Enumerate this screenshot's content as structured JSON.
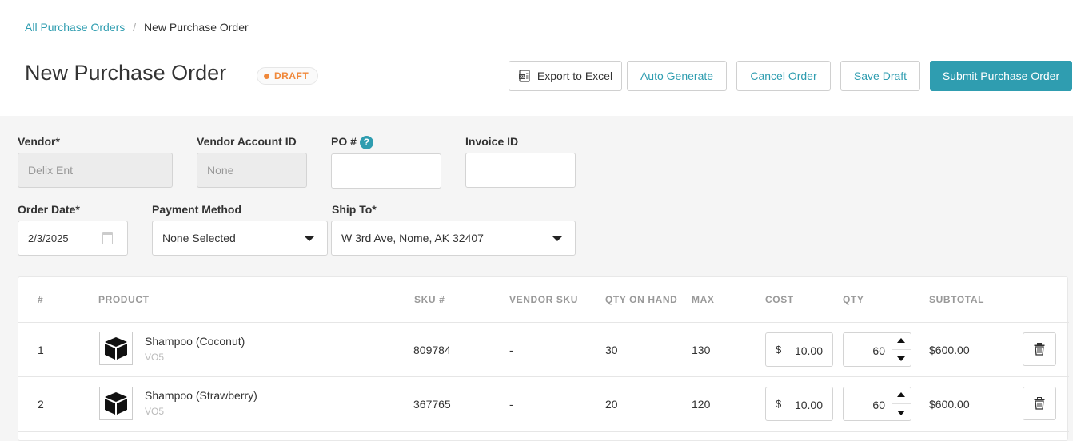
{
  "breadcrumb": {
    "parent": "All Purchase Orders",
    "separator": "/",
    "current": "New Purchase Order"
  },
  "page": {
    "title": "New Purchase Order",
    "status": "DRAFT"
  },
  "toolbar": {
    "export_label": "Export to Excel",
    "auto_label": "Auto Generate",
    "cancel_label": "Cancel Order",
    "save_label": "Save Draft",
    "submit_label": "Submit Purchase Order"
  },
  "form": {
    "vendor_label": "Vendor*",
    "vendor_value": "Delix Ent",
    "vendor_account_label": "Vendor Account ID",
    "vendor_account_value": "None",
    "po_label": "PO #",
    "po_value": "",
    "invoice_label": "Invoice ID",
    "invoice_value": "",
    "order_date_label": "Order Date*",
    "order_date_value": "2/3/2025",
    "payment_label": "Payment Method",
    "payment_value": "None Selected",
    "ship_label": "Ship To*",
    "ship_value": "W 3rd Ave, Nome, AK 32407"
  },
  "table": {
    "headers": {
      "num": "#",
      "product": "PRODUCT",
      "sku": "SKU #",
      "vendor_sku": "VENDOR SKU",
      "qty_on_hand": "QTY ON HAND",
      "max": "MAX",
      "cost": "COST",
      "qty": "QTY",
      "subtotal": "SUBTOTAL"
    },
    "currency_symbol": "$",
    "rows": [
      {
        "num": "1",
        "name": "Shampoo (Coconut)",
        "brand": "VO5",
        "sku": "809784",
        "vendor_sku": "-",
        "qty_on_hand": "30",
        "max": "130",
        "cost": "10.00",
        "qty": "60",
        "subtotal": "$600.00"
      },
      {
        "num": "2",
        "name": "Shampoo (Strawberry)",
        "brand": "VO5",
        "sku": "367765",
        "vendor_sku": "-",
        "qty_on_hand": "20",
        "max": "120",
        "cost": "10.00",
        "qty": "60",
        "subtotal": "$600.00"
      }
    ]
  },
  "colors": {
    "accent": "#2f9db0",
    "draft": "#f0883a"
  },
  "icons": {
    "export": "excel-icon",
    "help": "help-icon",
    "calendar": "calendar-icon",
    "dropdown": "chevron-down-icon",
    "product": "box-icon",
    "delete": "trash-icon"
  }
}
